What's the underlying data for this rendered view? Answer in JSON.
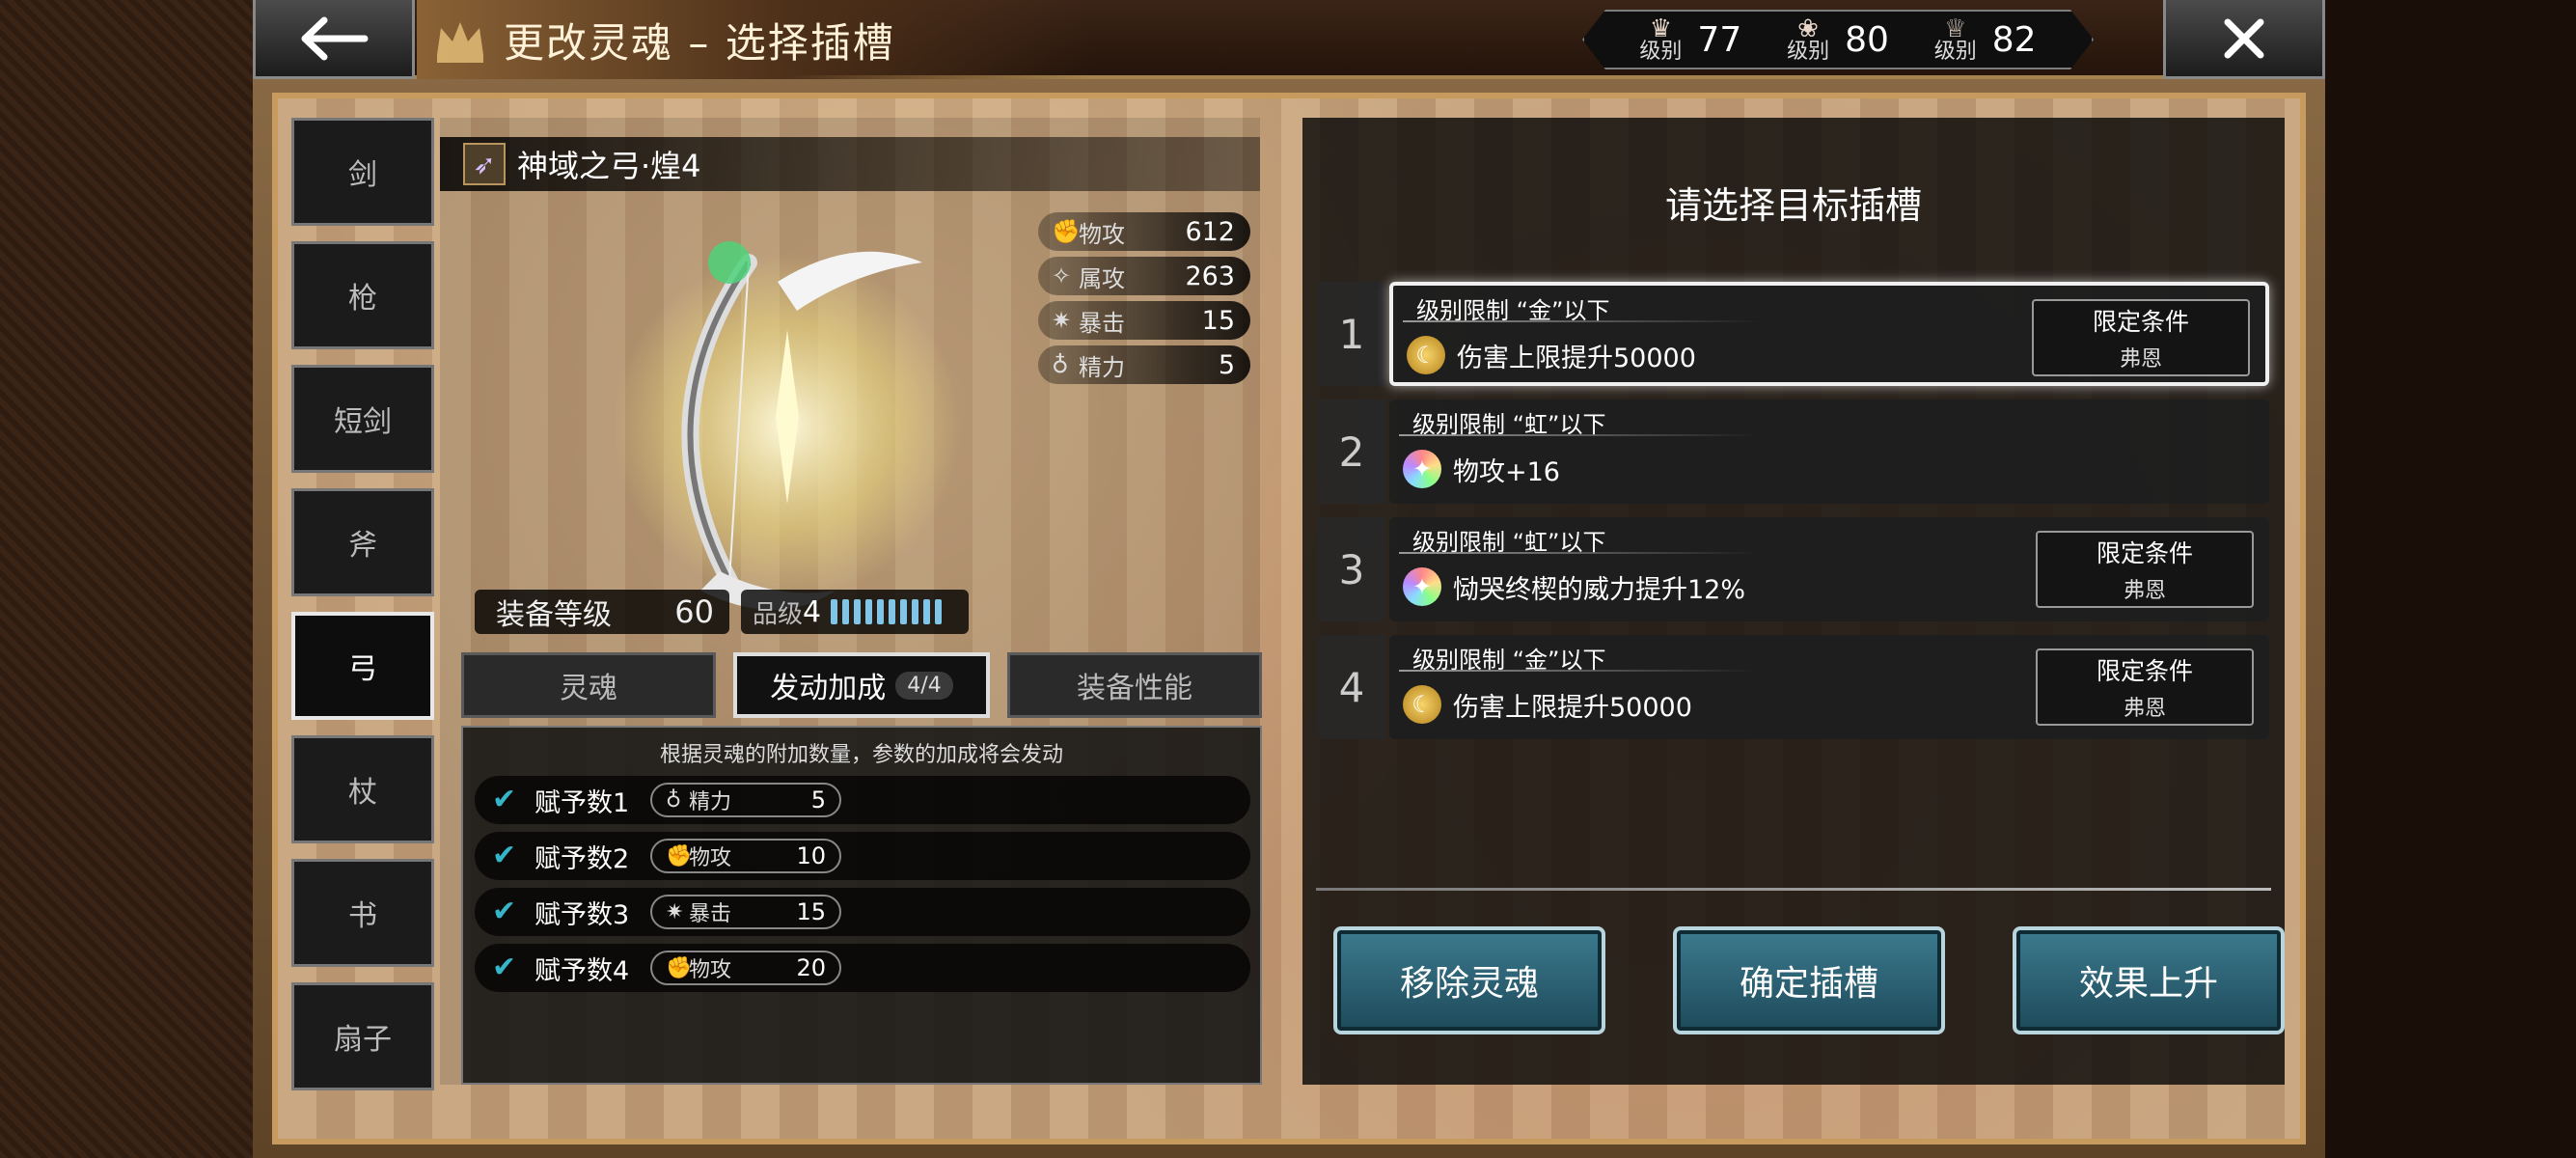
{
  "header": {
    "title": "更改灵魂 – 选择插槽",
    "levels": [
      {
        "label": "级别",
        "value": "77",
        "icon": "crown-icon"
      },
      {
        "label": "级别",
        "value": "80",
        "icon": "lotus-icon"
      },
      {
        "label": "级别",
        "value": "82",
        "icon": "tiara-icon"
      }
    ]
  },
  "categories": [
    "剑",
    "枪",
    "短剑",
    "斧",
    "弓",
    "杖",
    "书",
    "扇子"
  ],
  "active_category": "弓",
  "weapon": {
    "name": "神域之弓·煌4",
    "stats": [
      {
        "name": "物攻",
        "value": "612"
      },
      {
        "name": "属攻",
        "value": "263"
      },
      {
        "name": "暴击",
        "value": "15"
      },
      {
        "name": "精力",
        "value": "5"
      }
    ],
    "equip_level_label": "装备等级",
    "equip_level": "60",
    "grade_label": "品级",
    "grade": "4",
    "grade_pips": 10
  },
  "tabs": {
    "soul": "灵魂",
    "bonus": "发动加成",
    "bonus_count": "4/4",
    "performance": "装备性能"
  },
  "effects": {
    "note": "根据灵魂的附加数量，参数的加成将会发动",
    "rows": [
      {
        "label": "赋予数1",
        "stat": "精力",
        "value": "5"
      },
      {
        "label": "赋予数2",
        "stat": "物攻",
        "value": "10"
      },
      {
        "label": "赋予数3",
        "stat": "暴击",
        "value": "15"
      },
      {
        "label": "赋予数4",
        "stat": "物攻",
        "value": "20"
      }
    ]
  },
  "slots_panel": {
    "title": "请选择目标插槽",
    "slots": [
      {
        "num": "1",
        "req": "级别限制 “金”以下",
        "effect": "伤害上限提升50000",
        "gem": "gold",
        "cond1": "限定条件",
        "cond2": "弗恩"
      },
      {
        "num": "2",
        "req": "级别限制 “虹”以下",
        "effect": "物攻+16",
        "gem": "rainbow",
        "cond1": "",
        "cond2": ""
      },
      {
        "num": "3",
        "req": "级别限制 “虹”以下",
        "effect": "恸哭终楔的威力提升12%",
        "gem": "rainbow",
        "cond1": "限定条件",
        "cond2": "弗恩"
      },
      {
        "num": "4",
        "req": "级别限制 “金”以下",
        "effect": "伤害上限提升50000",
        "gem": "gold",
        "cond1": "限定条件",
        "cond2": "弗恩"
      }
    ],
    "buttons": {
      "remove": "移除灵魂",
      "confirm": "确定插槽",
      "upgrade": "效果上升"
    }
  }
}
